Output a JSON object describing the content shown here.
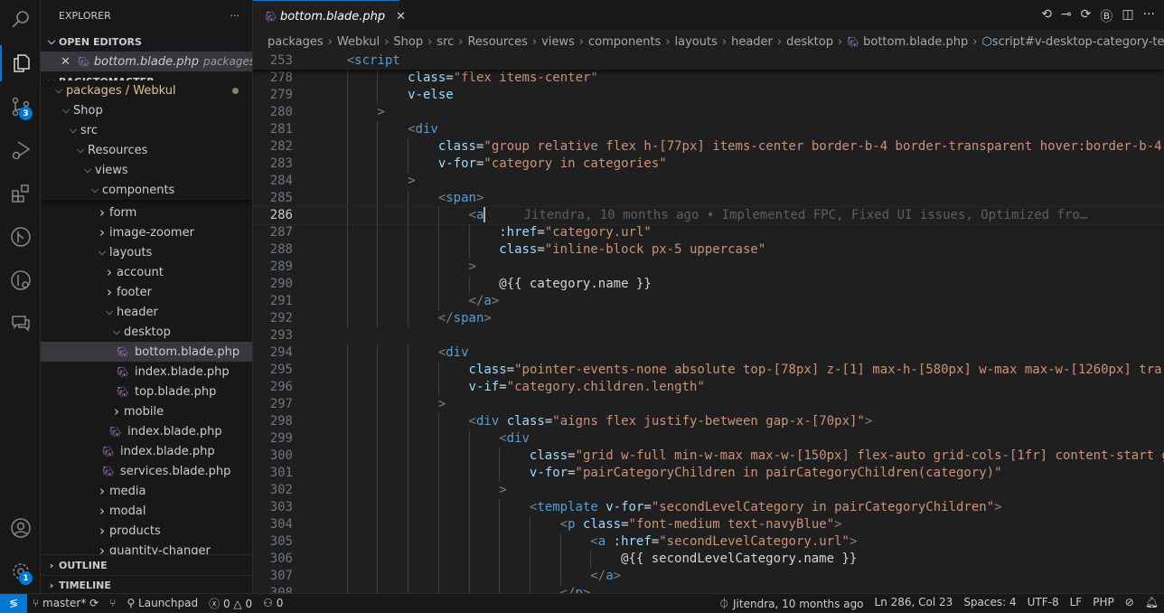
{
  "activity": {
    "scm_badge": "3",
    "accounts_badge": "1"
  },
  "sidebar": {
    "title": "EXPLORER",
    "more": "···",
    "open_editors": "OPEN EDITORS",
    "open_file": {
      "name": "bottom.blade.php",
      "path": "packages..."
    },
    "project": "BAGISTOMASTER",
    "sticky": [
      {
        "label": "packages / Webkul",
        "level": 0,
        "open": true,
        "modified": true
      },
      {
        "label": "Shop",
        "level": 1,
        "open": true
      },
      {
        "label": "src",
        "level": 2,
        "open": true
      },
      {
        "label": "Resources",
        "level": 3,
        "open": true
      },
      {
        "label": "views",
        "level": 4,
        "open": true
      },
      {
        "label": "components",
        "level": 5,
        "open": true
      }
    ],
    "items": [
      {
        "label": "form",
        "level": 6,
        "type": "folder"
      },
      {
        "label": "image-zoomer",
        "level": 6,
        "type": "folder"
      },
      {
        "label": "layouts",
        "level": 6,
        "type": "open"
      },
      {
        "label": "account",
        "level": 7,
        "type": "folder"
      },
      {
        "label": "footer",
        "level": 7,
        "type": "folder"
      },
      {
        "label": "header",
        "level": 7,
        "type": "open"
      },
      {
        "label": "desktop",
        "level": 8,
        "type": "open"
      },
      {
        "label": "bottom.blade.php",
        "level": 9,
        "type": "file",
        "selected": true
      },
      {
        "label": "index.blade.php",
        "level": 9,
        "type": "file"
      },
      {
        "label": "top.blade.php",
        "level": 9,
        "type": "file"
      },
      {
        "label": "mobile",
        "level": 8,
        "type": "folder"
      },
      {
        "label": "index.blade.php",
        "level": 8,
        "type": "file"
      },
      {
        "label": "index.blade.php",
        "level": 7,
        "type": "file"
      },
      {
        "label": "services.blade.php",
        "level": 7,
        "type": "file"
      },
      {
        "label": "media",
        "level": 6,
        "type": "folder"
      },
      {
        "label": "modal",
        "level": 6,
        "type": "folder"
      },
      {
        "label": "products",
        "level": 6,
        "type": "folder"
      },
      {
        "label": "quantity-changer",
        "level": 6,
        "type": "folder"
      }
    ],
    "outline": "OUTLINE",
    "timeline": "TIMELINE"
  },
  "tab": {
    "label": "bottom.blade.php",
    "close": "✕"
  },
  "breadcrumb": [
    "packages",
    "Webkul",
    "Shop",
    "src",
    "Resources",
    "views",
    "components",
    "layouts",
    "header",
    "desktop",
    "bottom.blade.php",
    "script#v-desktop-category-template"
  ],
  "code": {
    "sticky": {
      "n": "253",
      "indent": 1,
      "tokens": [
        [
          "<",
          "p"
        ],
        [
          "script",
          "tag"
        ]
      ]
    },
    "current_line": "286",
    "lines": [
      {
        "n": "278",
        "indent": 3,
        "tokens": [
          [
            "class",
            "attr"
          ],
          [
            "=",
            "txt"
          ],
          [
            "\"flex items-center\"",
            "str"
          ]
        ]
      },
      {
        "n": "279",
        "indent": 3,
        "tokens": [
          [
            "v-else",
            "attr"
          ]
        ]
      },
      {
        "n": "280",
        "indent": 2,
        "tokens": [
          [
            ">",
            "p"
          ]
        ]
      },
      {
        "n": "281",
        "indent": 3,
        "tokens": [
          [
            "<",
            "p"
          ],
          [
            "div",
            "tag"
          ]
        ]
      },
      {
        "n": "282",
        "indent": 4,
        "tokens": [
          [
            "class",
            "attr"
          ],
          [
            "=",
            "txt"
          ],
          [
            "\"group relative flex h-[77px] items-center border-b-4 border-transparent hover:border-b-4",
            "str"
          ]
        ]
      },
      {
        "n": "283",
        "indent": 4,
        "tokens": [
          [
            "v-for",
            "attr"
          ],
          [
            "=",
            "txt"
          ],
          [
            "\"category in categories\"",
            "str"
          ]
        ]
      },
      {
        "n": "284",
        "indent": 3,
        "tokens": [
          [
            ">",
            "p"
          ]
        ]
      },
      {
        "n": "285",
        "indent": 4,
        "tokens": [
          [
            "<",
            "p"
          ],
          [
            "span",
            "tag"
          ],
          [
            ">",
            "p"
          ]
        ]
      },
      {
        "n": "286",
        "indent": 5,
        "tokens": [
          [
            "<",
            "p"
          ],
          [
            "a",
            "tag"
          ]
        ],
        "blame": "Jitendra, 10 months ago • Implemented FPC, Fixed UI issues, Optimized fro…"
      },
      {
        "n": "287",
        "indent": 6,
        "tokens": [
          [
            ":href",
            "attr"
          ],
          [
            "=",
            "txt"
          ],
          [
            "\"category.url\"",
            "str"
          ]
        ]
      },
      {
        "n": "288",
        "indent": 6,
        "tokens": [
          [
            "class",
            "attr"
          ],
          [
            "=",
            "txt"
          ],
          [
            "\"inline-block px-5 uppercase\"",
            "str"
          ]
        ]
      },
      {
        "n": "289",
        "indent": 5,
        "tokens": [
          [
            ">",
            "p"
          ]
        ]
      },
      {
        "n": "290",
        "indent": 6,
        "tokens": [
          [
            "@{{ category.name }}",
            "txt"
          ]
        ]
      },
      {
        "n": "291",
        "indent": 5,
        "tokens": [
          [
            "</",
            "p"
          ],
          [
            "a",
            "tag"
          ],
          [
            ">",
            "p"
          ]
        ]
      },
      {
        "n": "292",
        "indent": 4,
        "tokens": [
          [
            "</",
            "p"
          ],
          [
            "span",
            "tag"
          ],
          [
            ">",
            "p"
          ]
        ]
      },
      {
        "n": "293",
        "indent": 0,
        "tokens": []
      },
      {
        "n": "294",
        "indent": 4,
        "tokens": [
          [
            "<",
            "p"
          ],
          [
            "div",
            "tag"
          ]
        ]
      },
      {
        "n": "295",
        "indent": 5,
        "tokens": [
          [
            "class",
            "attr"
          ],
          [
            "=",
            "txt"
          ],
          [
            "\"pointer-events-none absolute top-[78px] z-[1] max-h-[580px] w-max max-w-[1260px] tra",
            "str"
          ]
        ]
      },
      {
        "n": "296",
        "indent": 5,
        "tokens": [
          [
            "v-if",
            "attr"
          ],
          [
            "=",
            "txt"
          ],
          [
            "\"category.children.length\"",
            "str"
          ]
        ]
      },
      {
        "n": "297",
        "indent": 4,
        "tokens": [
          [
            ">",
            "p"
          ]
        ]
      },
      {
        "n": "298",
        "indent": 5,
        "tokens": [
          [
            "<",
            "p"
          ],
          [
            "div",
            "tag"
          ],
          [
            " ",
            "txt"
          ],
          [
            "class",
            "attr"
          ],
          [
            "=",
            "txt"
          ],
          [
            "\"aigns flex justify-between gap-x-[70px]\"",
            "str"
          ],
          [
            ">",
            "p"
          ]
        ]
      },
      {
        "n": "299",
        "indent": 6,
        "tokens": [
          [
            "<",
            "p"
          ],
          [
            "div",
            "tag"
          ]
        ]
      },
      {
        "n": "300",
        "indent": 7,
        "tokens": [
          [
            "class",
            "attr"
          ],
          [
            "=",
            "txt"
          ],
          [
            "\"grid w-full min-w-max max-w-[150px] flex-auto grid-cols-[1fr] content-start g",
            "str"
          ]
        ]
      },
      {
        "n": "301",
        "indent": 7,
        "tokens": [
          [
            "v-for",
            "attr"
          ],
          [
            "=",
            "txt"
          ],
          [
            "\"pairCategoryChildren in pairCategoryChildren(category)\"",
            "str"
          ]
        ]
      },
      {
        "n": "302",
        "indent": 6,
        "tokens": [
          [
            ">",
            "p"
          ]
        ]
      },
      {
        "n": "303",
        "indent": 7,
        "tokens": [
          [
            "<",
            "p"
          ],
          [
            "template",
            "tag"
          ],
          [
            " ",
            "txt"
          ],
          [
            "v-for",
            "attr"
          ],
          [
            "=",
            "txt"
          ],
          [
            "\"secondLevelCategory in pairCategoryChildren\"",
            "str"
          ],
          [
            ">",
            "p"
          ]
        ]
      },
      {
        "n": "304",
        "indent": 8,
        "tokens": [
          [
            "<",
            "p"
          ],
          [
            "p",
            "tag"
          ],
          [
            " ",
            "txt"
          ],
          [
            "class",
            "attr"
          ],
          [
            "=",
            "txt"
          ],
          [
            "\"font-medium text-navyBlue\"",
            "str"
          ],
          [
            ">",
            "p"
          ]
        ]
      },
      {
        "n": "305",
        "indent": 9,
        "tokens": [
          [
            "<",
            "p"
          ],
          [
            "a",
            "tag"
          ],
          [
            " ",
            "txt"
          ],
          [
            ":href",
            "attr"
          ],
          [
            "=",
            "txt"
          ],
          [
            "\"secondLevelCategory.url\"",
            "str"
          ],
          [
            ">",
            "p"
          ]
        ]
      },
      {
        "n": "306",
        "indent": 10,
        "tokens": [
          [
            "@{{ secondLevelCategory.name }}",
            "txt"
          ]
        ]
      },
      {
        "n": "307",
        "indent": 9,
        "tokens": [
          [
            "</",
            "p"
          ],
          [
            "a",
            "tag"
          ],
          [
            ">",
            "p"
          ]
        ]
      },
      {
        "n": "308",
        "indent": 8,
        "tokens": [
          [
            "</",
            "p"
          ],
          [
            "p",
            "tag"
          ],
          [
            ">",
            "p"
          ]
        ]
      }
    ]
  },
  "status": {
    "branch": "master*",
    "launchpad": "Launchpad",
    "errors": "0",
    "warnings": "0",
    "ports": "0",
    "blame": "Jitendra, 10 months ago",
    "position": "Ln 286, Col 23",
    "spaces": "Spaces: 4",
    "encoding": "UTF-8",
    "eol": "LF",
    "language": "PHP"
  },
  "colors": {
    "accent": "#0078d4",
    "php_icon": "#a074c4",
    "folder_modified": "#e2c08d"
  }
}
